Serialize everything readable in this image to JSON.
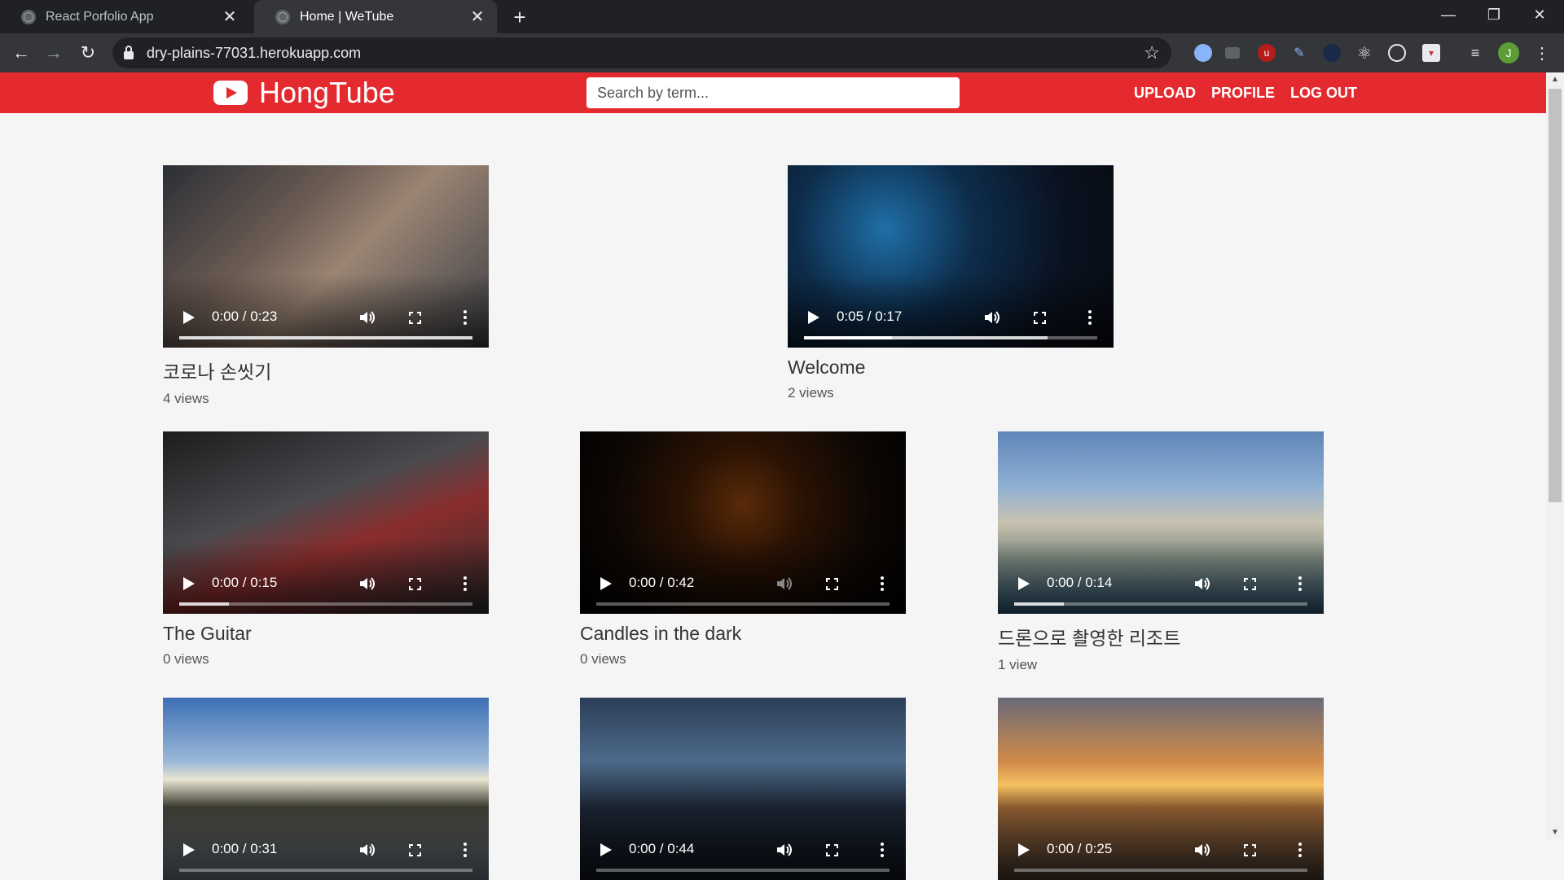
{
  "browser": {
    "tabs": [
      {
        "title": "React Porfolio App",
        "active": false
      },
      {
        "title": "Home | WeTube",
        "active": true
      }
    ],
    "url": "dry-plains-77031.herokuapp.com",
    "profile_initial": "J"
  },
  "site": {
    "logo": "HongTube",
    "search_placeholder": "Search by term...",
    "nav": [
      "UPLOAD",
      "PROFILE",
      "LOG OUT"
    ]
  },
  "videos": [
    {
      "title": "코로나 손씻기",
      "views": "4 views",
      "time": "0:00 / 0:23",
      "progress": 0.0,
      "buffered": 1.0
    },
    {
      "title": "Welcome",
      "views": "2 views",
      "time": "0:05 / 0:17",
      "progress": 0.3,
      "buffered": 0.83
    },
    {
      "title": "The Guitar",
      "views": "0 views",
      "time": "0:00 / 0:15",
      "progress": 0.0,
      "buffered": 0.17
    },
    {
      "title": "Candles in the dark",
      "views": "0 views",
      "time": "0:00 / 0:42",
      "progress": 0.0,
      "buffered": 0.0
    },
    {
      "title": "드론으로 촬영한 리조트",
      "views": "1 view",
      "time": "0:00 / 0:14",
      "progress": 0.0,
      "buffered": 0.17
    },
    {
      "title": "",
      "views": "",
      "time": "0:00 / 0:31",
      "progress": 0.0,
      "buffered": 0.0
    },
    {
      "title": "",
      "views": "",
      "time": "0:00 / 0:44",
      "progress": 0.0,
      "buffered": 0.0
    },
    {
      "title": "",
      "views": "",
      "time": "0:00 / 0:25",
      "progress": 0.0,
      "buffered": 0.0
    }
  ],
  "colors": {
    "brand": "#e52a2f",
    "tabbar": "#202124",
    "toolbar": "#35363a"
  }
}
